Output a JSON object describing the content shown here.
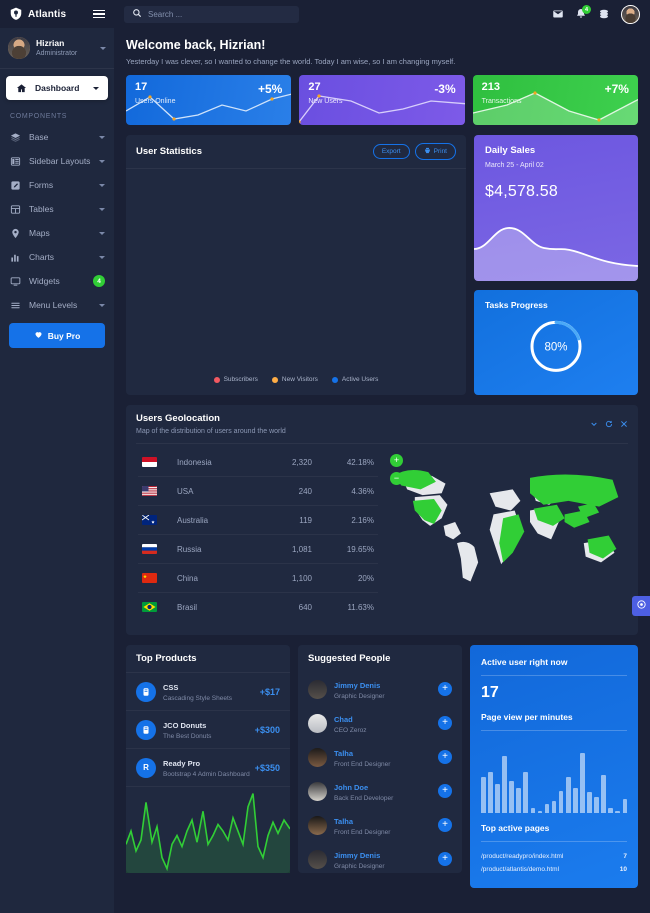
{
  "brand": {
    "name": "Atlantis",
    "logo_icon": "shield-logo-icon",
    "menu_icon": "hamburger-icon"
  },
  "sidebar": {
    "user": {
      "name": "Hizrian",
      "role": "Administrator",
      "avatar": "user-avatar",
      "caret_icon": "caret-down-icon"
    },
    "active_item": {
      "label": "Dashboard",
      "icon": "home-icon",
      "caret_icon": "caret-down-icon"
    },
    "section_label": "COMPONENTS",
    "items": [
      {
        "label": "Base",
        "icon": "layers-icon",
        "caret": true
      },
      {
        "label": "Sidebar Layouts",
        "icon": "sidebar-icon",
        "caret": true
      },
      {
        "label": "Forms",
        "icon": "form-icon",
        "caret": true
      },
      {
        "label": "Tables",
        "icon": "table-icon",
        "caret": true
      },
      {
        "label": "Maps",
        "icon": "map-pin-icon",
        "caret": true
      },
      {
        "label": "Charts",
        "icon": "bar-chart-icon",
        "caret": true
      },
      {
        "label": "Widgets",
        "icon": "monitor-icon",
        "badge": "4"
      },
      {
        "label": "Menu Levels",
        "icon": "menu-lines-icon",
        "caret": true
      }
    ],
    "buy_pro": {
      "label": "Buy Pro",
      "icon": "heart-icon"
    }
  },
  "topbar": {
    "search": {
      "placeholder": "Search ...",
      "value": "",
      "icon": "search-icon"
    },
    "icons": [
      {
        "name": "envelope-icon",
        "badge": ""
      },
      {
        "name": "bell-icon",
        "badge": "4"
      },
      {
        "name": "layers-icon",
        "badge": ""
      }
    ],
    "avatar": "user-avatar"
  },
  "welcome": {
    "title": "Welcome back, Hizrian!",
    "subtitle": "Yesterday I was clever, so I wanted to change the world. Today I am wise, so I am changing myself."
  },
  "stat_cards": [
    {
      "value": "17",
      "label": "Users Online",
      "percent": "+5%",
      "color": "#1572e8"
    },
    {
      "value": "27",
      "label": "New Users",
      "percent": "-3%",
      "color": "#6a4fe0"
    },
    {
      "value": "213",
      "label": "Transactions",
      "percent": "+7%",
      "color": "#31ce36"
    }
  ],
  "user_statistics": {
    "title": "User Statistics",
    "export_label": "Export",
    "print_label": "Print",
    "print_icon": "printer-icon",
    "legend": [
      {
        "label": "Subscribers",
        "color": "#f25961"
      },
      {
        "label": "New Visitors",
        "color": "#ffad46"
      },
      {
        "label": "Active Users",
        "color": "#1572e8"
      }
    ]
  },
  "daily_sales": {
    "title": "Daily Sales",
    "range": "March 25 - April 02",
    "amount": "$4,578.58"
  },
  "tasks_progress": {
    "title": "Tasks Progress",
    "percent_label": "80%",
    "percent": 80
  },
  "geolocation": {
    "title": "Users Geolocation",
    "subtitle": "Map of the distribution of users around the world",
    "actions": [
      {
        "name": "collapse-icon"
      },
      {
        "name": "refresh-icon"
      },
      {
        "name": "close-icon"
      }
    ],
    "zoom_in": "+",
    "zoom_out": "−",
    "rows": [
      {
        "country": "Indonesia",
        "count": "2,320",
        "percent": "42.18%",
        "flag": "flag-indonesia"
      },
      {
        "country": "USA",
        "count": "240",
        "percent": "4.36%",
        "flag": "flag-usa"
      },
      {
        "country": "Australia",
        "count": "119",
        "percent": "2.16%",
        "flag": "flag-australia"
      },
      {
        "country": "Russia",
        "count": "1,081",
        "percent": "19.65%",
        "flag": "flag-russia"
      },
      {
        "country": "China",
        "count": "1,100",
        "percent": "20%",
        "flag": "flag-china"
      },
      {
        "country": "Brasil",
        "count": "640",
        "percent": "11.63%",
        "flag": "flag-brasil"
      }
    ]
  },
  "top_products": {
    "title": "Top Products",
    "items": [
      {
        "name": "CSS",
        "desc": "Cascading Style Sheets",
        "amount": "+$17",
        "icon": "database-icon"
      },
      {
        "name": "JCO Donuts",
        "desc": "The Best Donuts",
        "amount": "+$300",
        "icon": "database-icon"
      },
      {
        "name": "Ready Pro",
        "desc": "Bootstrap 4 Admin Dashboard",
        "amount": "+$350",
        "icon": "R"
      }
    ]
  },
  "suggested_people": {
    "title": "Suggested People",
    "add_icon": "plus-icon",
    "items": [
      {
        "name": "Jimmy Denis",
        "role": "Graphic Designer"
      },
      {
        "name": "Chad",
        "role": "CEO Zeroz"
      },
      {
        "name": "Talha",
        "role": "Front End Designer"
      },
      {
        "name": "John Doe",
        "role": "Back End Developer"
      },
      {
        "name": "Talha",
        "role": "Front End Designer"
      },
      {
        "name": "Jimmy Denis",
        "role": "Graphic Designer"
      }
    ]
  },
  "active_users": {
    "active_label": "Active user right now",
    "active_count": "17",
    "pageview_label": "Page view per minutes",
    "top_pages_label": "Top active pages",
    "pages": [
      {
        "url": "/product/readypro/index.html",
        "count": "7"
      },
      {
        "url": "/product/atlantis/demo.html",
        "count": "10"
      }
    ]
  },
  "floating_button": {
    "icon": "gear-icon"
  },
  "chart_data": [
    {
      "type": "line",
      "title": "Users Online sparkline",
      "values": [
        28,
        62,
        10,
        34,
        26,
        48,
        22,
        70
      ],
      "color": "#cfe3fb"
    },
    {
      "type": "line",
      "title": "New Users sparkline",
      "values": [
        5,
        70,
        58,
        44,
        24,
        38,
        58,
        46
      ],
      "color": "#d7cefb"
    },
    {
      "type": "line",
      "title": "Transactions sparkline",
      "values": [
        22,
        34,
        72,
        40,
        30,
        14,
        44,
        66
      ],
      "color": "#d7f5d9"
    },
    {
      "type": "area",
      "title": "Daily Sales",
      "values": [
        30,
        34,
        58,
        62,
        48,
        42,
        44,
        30,
        22,
        18,
        16
      ],
      "color": "#ffffff"
    },
    {
      "type": "area",
      "title": "Top Products trend",
      "values": [
        38,
        52,
        34,
        44,
        82,
        40,
        56,
        24,
        8,
        32,
        40,
        30,
        46,
        58,
        34,
        66,
        30,
        40,
        52,
        44,
        36,
        60,
        46,
        30,
        70,
        88,
        34,
        22,
        40,
        54,
        46,
        58
      ],
      "color": "#31ce36"
    },
    {
      "type": "bar",
      "title": "Page view per minutes",
      "values": [
        58,
        66,
        46,
        92,
        52,
        40,
        66,
        8,
        4,
        14,
        20,
        36,
        58,
        40,
        96,
        34,
        26,
        62,
        8,
        4,
        22
      ],
      "color": "#ffffff",
      "ylim": [
        0,
        100
      ]
    }
  ]
}
